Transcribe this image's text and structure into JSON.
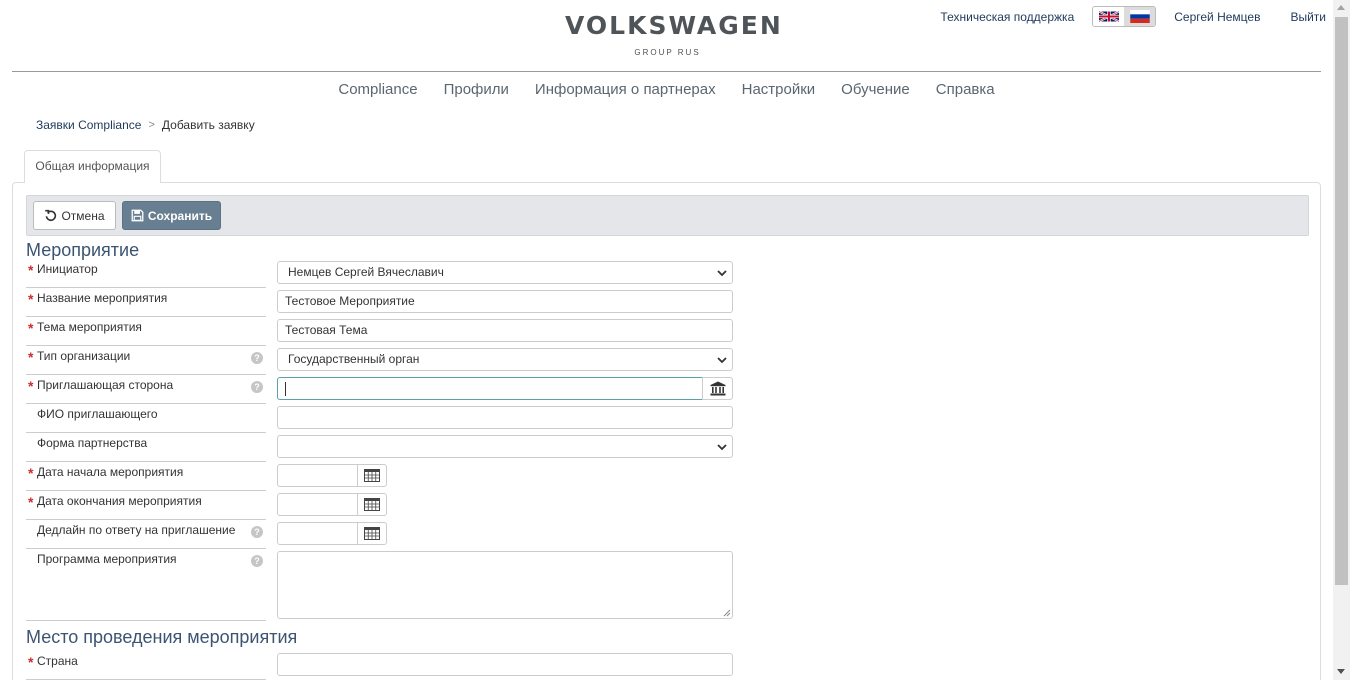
{
  "header": {
    "logo_main": "VOLKSWAGEN",
    "logo_sub": "GROUP RUS",
    "support_link": "Техническая поддержка",
    "user_name": "Сергей Немцев",
    "logout": "Выйти",
    "languages": [
      "uk-flag-icon",
      "ru-flag-icon"
    ],
    "active_language": "ru"
  },
  "nav": {
    "items": [
      "Compliance",
      "Профили",
      "Информация о партнерах",
      "Настройки",
      "Обучение",
      "Справка"
    ]
  },
  "breadcrumb": {
    "root": "Заявки Compliance",
    "separator": ">",
    "current": "Добавить заявку"
  },
  "tabs": {
    "general": "Общая информация"
  },
  "toolbar": {
    "cancel_label": "Отмена",
    "save_label": "Сохранить"
  },
  "sections": {
    "event_title": "Мероприятие",
    "venue_title": "Место проведения мероприятия"
  },
  "fields": {
    "initiator": {
      "label": "Инициатор",
      "value": "Немцев Сергей Вячеславич",
      "required": true
    },
    "event_name": {
      "label": "Название мероприятия",
      "value": "Тестовое Мероприятие",
      "required": true
    },
    "event_topic": {
      "label": "Тема мероприятия",
      "value": "Тестовая Тема",
      "required": true
    },
    "org_type": {
      "label": "Тип организации",
      "value": "Государственный орган",
      "required": true
    },
    "inviting_party": {
      "label": "Приглашающая сторона",
      "value": "",
      "required": true
    },
    "inviter_name": {
      "label": "ФИО приглашающего",
      "value": "",
      "required": false
    },
    "partnership_form": {
      "label": "Форма партнерства",
      "value": "",
      "required": false
    },
    "start_date": {
      "label": "Дата начала мероприятия",
      "value": "",
      "required": true
    },
    "end_date": {
      "label": "Дата окончания мероприятия",
      "value": "",
      "required": true
    },
    "deadline": {
      "label": "Дедлайн по ответу на приглашение",
      "value": "",
      "required": false
    },
    "program": {
      "label": "Программа мероприятия",
      "value": "",
      "required": false
    },
    "country": {
      "label": "Страна",
      "value": "",
      "required": true
    }
  },
  "colors": {
    "brand_text": "#4f5458",
    "link": "#1f3a5c",
    "section_title": "#3b5472",
    "required": "#c9302c",
    "save_button": "#677f91",
    "toolbar_bg": "#e4e6e9",
    "focus_border": "#5aa2a8"
  },
  "symbols": {
    "required_mark": "*",
    "help_mark": "?"
  }
}
